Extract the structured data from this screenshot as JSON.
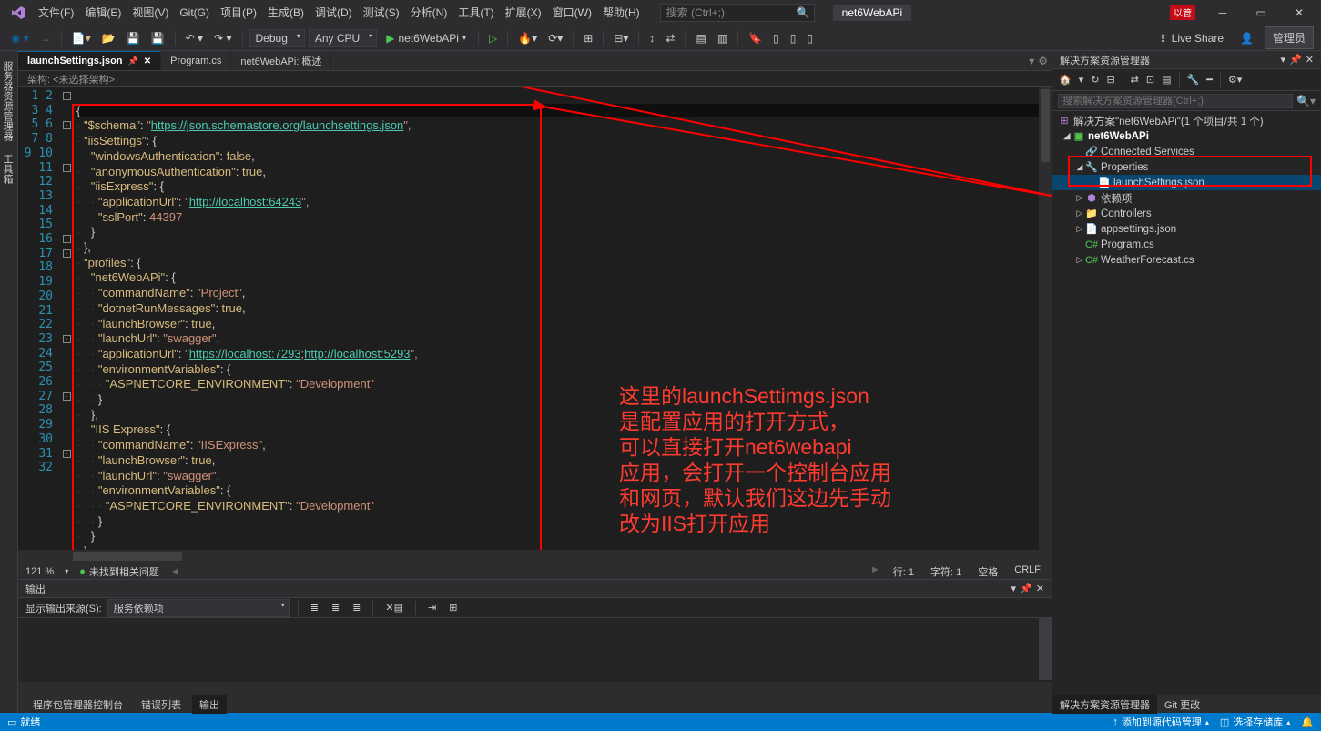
{
  "menu": [
    "文件(F)",
    "编辑(E)",
    "视图(V)",
    "Git(G)",
    "项目(P)",
    "生成(B)",
    "调试(D)",
    "测试(S)",
    "分析(N)",
    "工具(T)",
    "扩展(X)",
    "窗口(W)",
    "帮助(H)"
  ],
  "search_placeholder": "搜索 (Ctrl+;)",
  "project_name": "net6WebAPi",
  "admin_badge": "以管",
  "toolbar": {
    "config": "Debug",
    "platform": "Any CPU",
    "run_target": "net6WebAPi",
    "live_share": "Live Share",
    "admin_btn": "管理员"
  },
  "vert_tabs": [
    "服务器资源管理器",
    "工具箱"
  ],
  "file_tabs": [
    {
      "name": "launchSettings.json",
      "active": true,
      "pinned": true
    },
    {
      "name": "Program.cs",
      "active": false
    },
    {
      "name": "net6WebAPi: 概述",
      "active": false
    }
  ],
  "breadcrumb_label": "架构:",
  "breadcrumb_value": "<未选择架构>",
  "code_lines": 32,
  "code": {
    "l1": "{",
    "l2a": "\"$schema\"",
    "l2b": ": ",
    "l2c": "\"",
    "l2url": "https://json.schemastore.org/launchsettings.json",
    "l2d": "\",",
    "l3a": "\"iisSettings\"",
    "l3b": ": {",
    "l4a": "\"windowsAuthentication\"",
    "l4b": ": ",
    "l4c": "false",
    "l4d": ",",
    "l5a": "\"anonymousAuthentication\"",
    "l5b": ": ",
    "l5c": "true",
    "l5d": ",",
    "l6a": "\"iisExpress\"",
    "l6b": ": {",
    "l7a": "\"applicationUrl\"",
    "l7b": ": ",
    "l7c": "\"",
    "l7url": "http://localhost:64243",
    "l7d": "\",",
    "l8a": "\"sslPort\"",
    "l8b": ": ",
    "l8c": "44397",
    "l9": "}",
    "l10": "},",
    "l11a": "\"profiles\"",
    "l11b": ": {",
    "l12a": "\"net6WebAPi\"",
    "l12b": ": {",
    "l13a": "\"commandName\"",
    "l13b": ": ",
    "l13c": "\"Project\"",
    "l13d": ",",
    "l14a": "\"dotnetRunMessages\"",
    "l14b": ": ",
    "l14c": "true",
    "l14d": ",",
    "l15a": "\"launchBrowser\"",
    "l15b": ": ",
    "l15c": "true",
    "l15d": ",",
    "l16a": "\"launchUrl\"",
    "l16b": ": ",
    "l16c": "\"swagger\"",
    "l16d": ",",
    "l17a": "\"applicationUrl\"",
    "l17b": ": ",
    "l17c": "\"",
    "l17url1": "https://localhost:7293",
    "l17sep": ";",
    "l17url2": "http://localhost:5293",
    "l17d": "\",",
    "l18a": "\"environmentVariables\"",
    "l18b": ": {",
    "l19a": "\"ASPNETCORE_ENVIRONMENT\"",
    "l19b": ": ",
    "l19c": "\"Development\"",
    "l20": "}",
    "l21": "},",
    "l22a": "\"IIS Express\"",
    "l22b": ": {",
    "l23a": "\"commandName\"",
    "l23b": ": ",
    "l23c": "\"IISExpress\"",
    "l23d": ",",
    "l24a": "\"launchBrowser\"",
    "l24b": ": ",
    "l24c": "true",
    "l24d": ",",
    "l25a": "\"launchUrl\"",
    "l25b": ": ",
    "l25c": "\"swagger\"",
    "l25d": ",",
    "l26a": "\"environmentVariables\"",
    "l26b": ": {",
    "l27a": "\"ASPNETCORE_ENVIRONMENT\"",
    "l27b": ": ",
    "l27c": "\"Development\"",
    "l28": "}",
    "l29": "}",
    "l30": "}",
    "l31": "}",
    "l32": ""
  },
  "annotation": "这里的launchSettimgs.json\n是配置应用的打开方式，\n可以直接打开net6webapi\n应用，会打开一个控制台应用\n和网页，默认我们这边先手动\n改为IIS打开应用",
  "editor_status": {
    "zoom": "121 %",
    "issues": "未找到相关问题",
    "line": "行: 1",
    "col": "字符: 1",
    "ins": "空格",
    "eol": "CRLF"
  },
  "output": {
    "title": "输出",
    "source_label": "显示输出来源(S):",
    "source_value": "服务依赖项"
  },
  "output_tabs": [
    "程序包管理器控制台",
    "错误列表",
    "输出"
  ],
  "output_tab_active": 2,
  "right_panel": {
    "title": "解决方案资源管理器",
    "search_placeholder": "搜索解决方案资源管理器(Ctrl+;)",
    "solution_label": "解决方案\"net6WebAPi\"(1 个项目/共 1 个)",
    "items": {
      "project": "net6WebAPi",
      "connected": "Connected Services",
      "properties": "Properties",
      "launch": "launchSettings.json",
      "deps": "依赖项",
      "controllers": "Controllers",
      "appsettings": "appsettings.json",
      "program": "Program.cs",
      "weather": "WeatherForecast.cs"
    }
  },
  "rp_bottom_tabs": [
    "解决方案资源管理器",
    "Git 更改"
  ],
  "statusbar": {
    "ready": "就绪",
    "source_control": "添加到源代码管理",
    "repo": "选择存储库"
  }
}
